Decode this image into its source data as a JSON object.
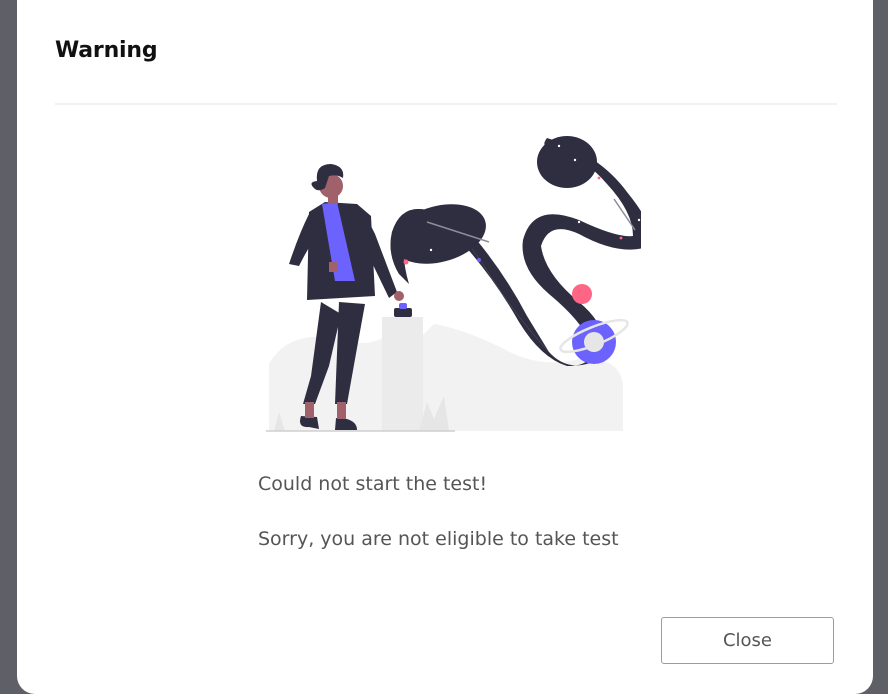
{
  "dialog": {
    "title": "Warning",
    "message_primary": "Could not start the test!",
    "message_secondary": "Sorry, you are not eligible to take test",
    "close_label": "Close"
  },
  "colors": {
    "accent": "#6c63ff",
    "dark": "#2f2e41",
    "skin": "#a0616a",
    "pink": "#ff6584",
    "background_overlay": "#5f6067"
  },
  "illustration": {
    "icon": "launch-rocket-illustration"
  }
}
